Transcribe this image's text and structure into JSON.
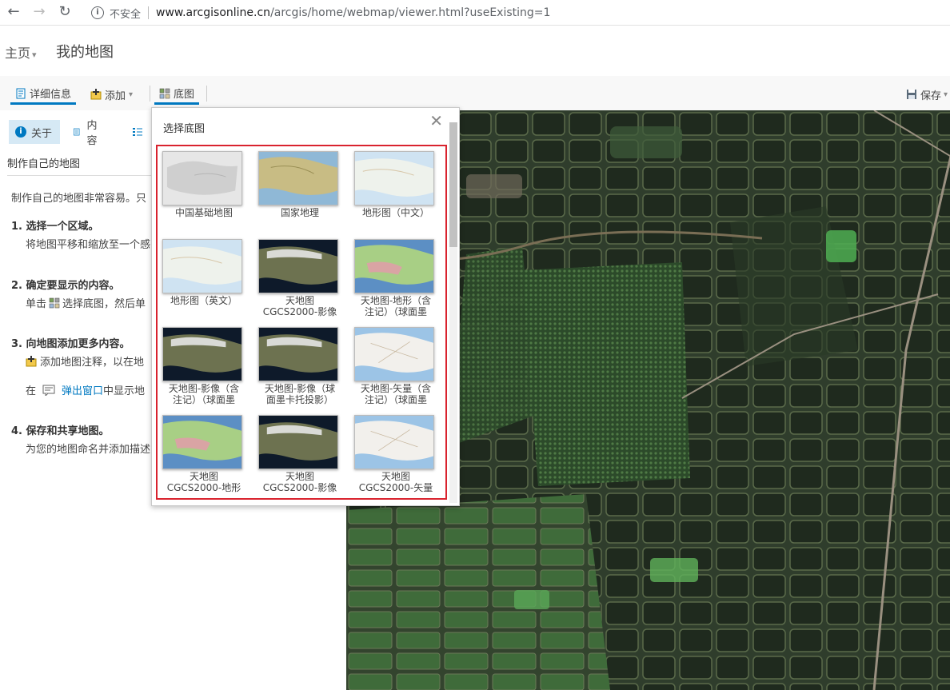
{
  "browser": {
    "back_icon": "←",
    "forward_icon": "→",
    "reload_icon": "↻",
    "insecure_label": "不安全",
    "url_domain": "www.arcgisonline.cn",
    "url_path": "/arcgis/home/webmap/viewer.html?useExisting=1"
  },
  "header": {
    "home_label": "主页",
    "home_chevron": "▾",
    "map_title": "我的地图"
  },
  "toolbar": {
    "details_label": "详细信息",
    "add_label": "添加",
    "add_chevron": "▾",
    "basemap_label": "底图",
    "save_label": "保存",
    "save_chevron": "▾"
  },
  "panel": {
    "tab_about": "关于",
    "tab_contents": "内容",
    "section_title": "制作自己的地图",
    "intro": "制作自己的地图非常容易。只",
    "step1_title": "1. 选择一个区域。",
    "step1_text": "将地图平移和缩放至一个感",
    "step2_title": "2. 确定要显示的内容。",
    "step2_text_a": "单击",
    "step2_text_b": "选择底图，然后单",
    "step3_title": "3. 向地图添加更多内容。",
    "step3_text": "添加地图注释，以在地",
    "step3_text2_a": "在",
    "step3_link": "弹出窗口",
    "step3_text2_b": "中显示地",
    "step4_title": "4. 保存和共享地图。",
    "step4_text": "为您的地图命名并添加描述"
  },
  "popup": {
    "title": "选择底图",
    "close_icon": "✕",
    "items": [
      {
        "label": "中国基础地图",
        "style": "gray"
      },
      {
        "label": "国家地理",
        "style": "natgeo"
      },
      {
        "label": "地形图（中文）",
        "style": "topo"
      },
      {
        "label": "地形图（英文）",
        "style": "topo"
      },
      {
        "label": "天地图\nCGCS2000-影像",
        "style": "imagery"
      },
      {
        "label": "天地图-地形（含\n注记）（球面墨",
        "style": "terrain"
      },
      {
        "label": "天地图-影像（含\n注记）（球面墨",
        "style": "imagery"
      },
      {
        "label": "天地图-影像（球\n面墨卡托投影）",
        "style": "imagery"
      },
      {
        "label": "天地图-矢量（含\n注记）（球面墨",
        "style": "vector"
      },
      {
        "label": "天地图\nCGCS2000-地形",
        "style": "terrain"
      },
      {
        "label": "天地图\nCGCS2000-影像",
        "style": "imagery"
      },
      {
        "label": "天地图\nCGCS2000-矢量",
        "style": "vector"
      }
    ]
  },
  "colors": {
    "accent": "#0079c1",
    "highlight_border": "#d9232e",
    "tab_active_bg": "#d6e9f5"
  }
}
